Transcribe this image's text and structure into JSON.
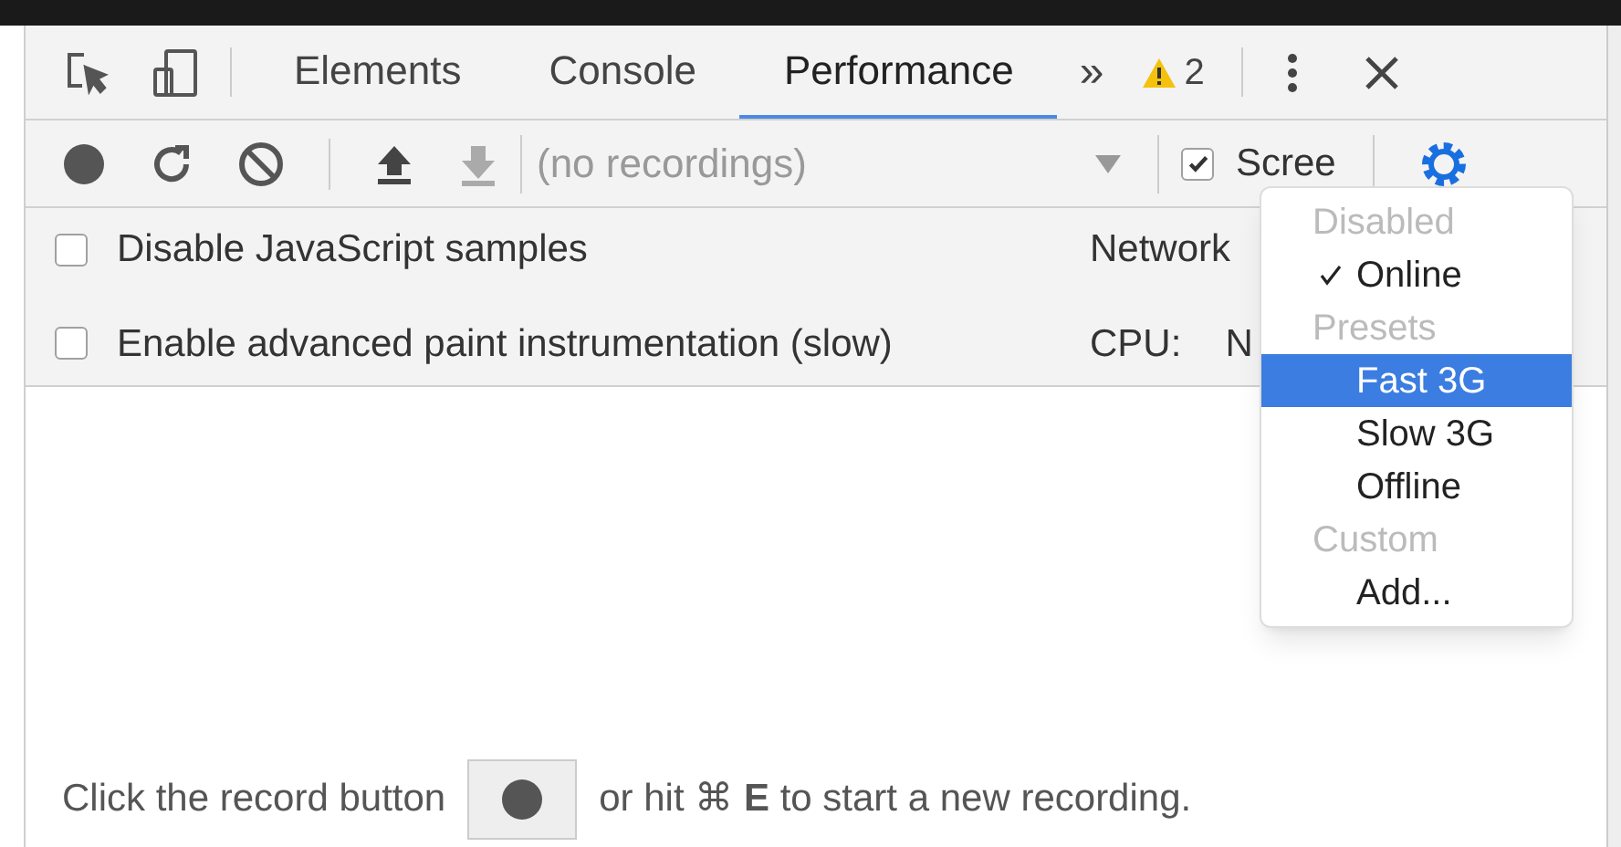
{
  "tabs": [
    {
      "label": "Elements",
      "selected": false
    },
    {
      "label": "Console",
      "selected": false
    },
    {
      "label": "Performance",
      "selected": true
    }
  ],
  "more_tabs": "»",
  "warnings": {
    "count": "2"
  },
  "toolbar": {
    "recordings": {
      "placeholder": "(no recordings)"
    },
    "screenshots": {
      "label": "Scree",
      "checked": true
    }
  },
  "settings": [
    {
      "label": "Disable JavaScript samples",
      "checked": false
    },
    {
      "label": "Enable advanced paint instrumentation (slow)",
      "checked": false
    }
  ],
  "network": {
    "label": "Network"
  },
  "cpu": {
    "label": "CPU:",
    "value": "N"
  },
  "network_menu": [
    {
      "kind": "header",
      "label": "Disabled"
    },
    {
      "kind": "option",
      "label": "Online",
      "checked": true,
      "selected": false
    },
    {
      "kind": "header",
      "label": "Presets"
    },
    {
      "kind": "option",
      "label": "Fast 3G",
      "checked": false,
      "selected": true
    },
    {
      "kind": "option",
      "label": "Slow 3G",
      "checked": false,
      "selected": false
    },
    {
      "kind": "option",
      "label": "Offline",
      "checked": false,
      "selected": false
    },
    {
      "kind": "header",
      "label": "Custom"
    },
    {
      "kind": "option",
      "label": "Add...",
      "checked": false,
      "selected": false
    }
  ],
  "hint": {
    "before": "Click the record button",
    "after": "or hit ⌘ **E** to start a new recording."
  }
}
